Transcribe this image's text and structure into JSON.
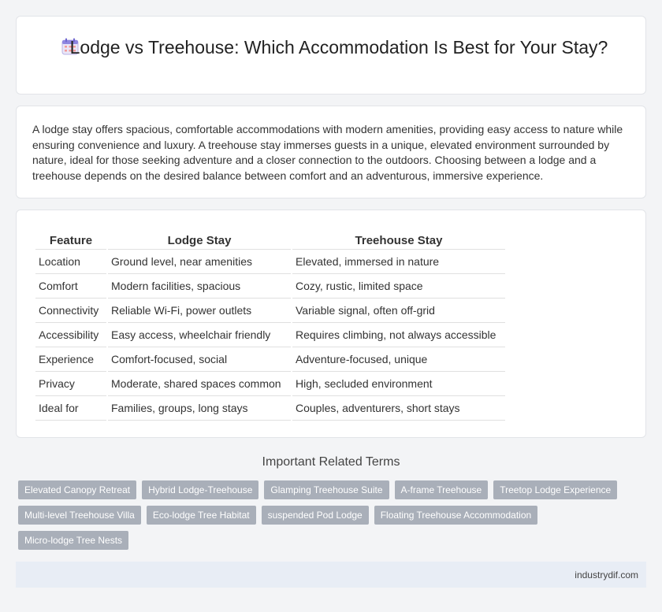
{
  "header": {
    "title": "Lodge vs Treehouse: Which Accommodation Is Best for Your Stay?",
    "icon": "calendar-icon"
  },
  "intro": {
    "text": "A lodge stay offers spacious, comfortable accommodations with modern amenities, providing easy access to nature while ensuring convenience and luxury. A treehouse stay immerses guests in a unique, elevated environment surrounded by nature, ideal for those seeking adventure and a closer connection to the outdoors. Choosing between a lodge and a treehouse depends on the desired balance between comfort and an adventurous, immersive experience."
  },
  "table": {
    "headers": [
      "Feature",
      "Lodge Stay",
      "Treehouse Stay"
    ],
    "rows": [
      [
        "Location",
        "Ground level, near amenities",
        "Elevated, immersed in nature"
      ],
      [
        "Comfort",
        "Modern facilities, spacious",
        "Cozy, rustic, limited space"
      ],
      [
        "Connectivity",
        "Reliable Wi-Fi, power outlets",
        "Variable signal, often off-grid"
      ],
      [
        "Accessibility",
        "Easy access, wheelchair friendly",
        "Requires climbing, not always accessible"
      ],
      [
        "Experience",
        "Comfort-focused, social",
        "Adventure-focused, unique"
      ],
      [
        "Privacy",
        "Moderate, shared spaces common",
        "High, secluded environment"
      ],
      [
        "Ideal for",
        "Families, groups, long stays",
        "Couples, adventurers, short stays"
      ]
    ]
  },
  "related": {
    "title": "Important Related Terms",
    "tags": [
      "Elevated Canopy Retreat",
      "Hybrid Lodge-Treehouse",
      "Glamping Treehouse Suite",
      "A-frame Treehouse",
      "Treetop Lodge Experience",
      "Multi-level Treehouse Villa",
      "Eco-lodge Tree Habitat",
      "suspended Pod Lodge",
      "Floating Treehouse Accommodation",
      "Micro-lodge Tree Nests"
    ]
  },
  "footer": {
    "site": "industrydif.com"
  }
}
